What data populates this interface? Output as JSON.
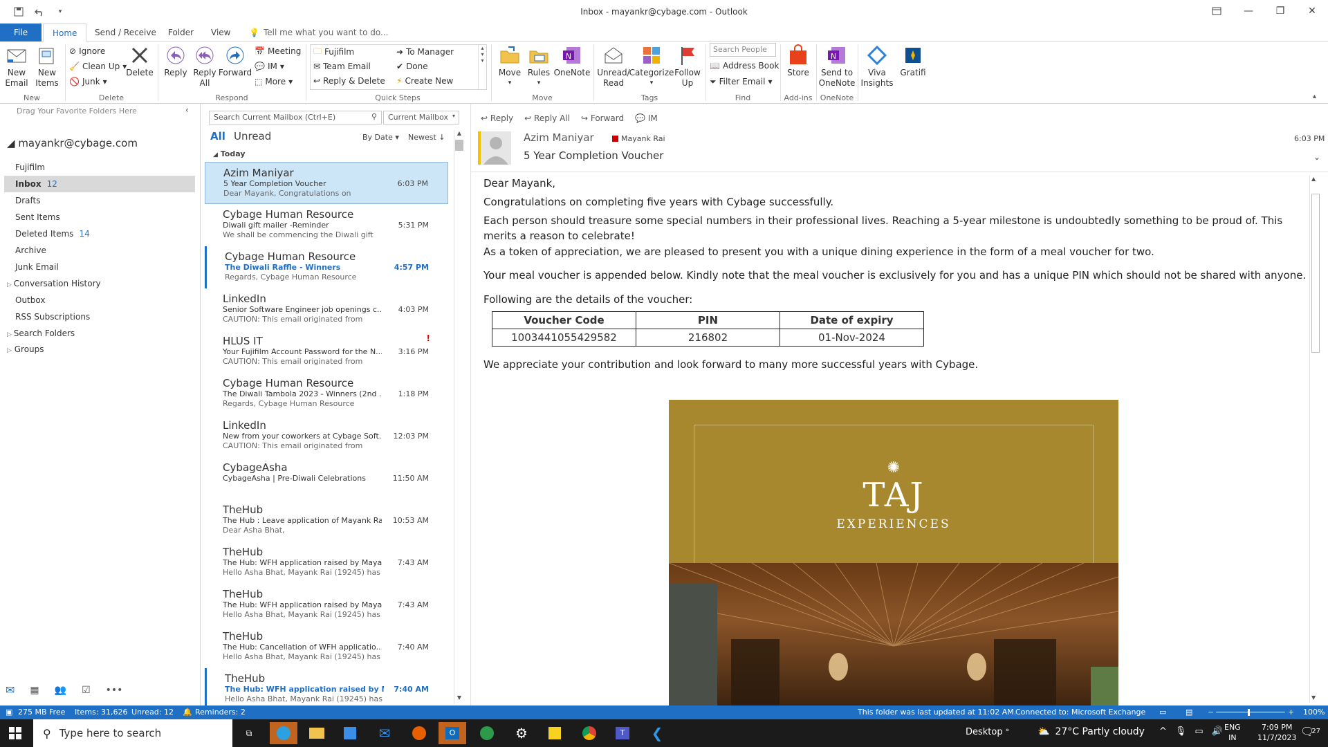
{
  "window": {
    "title": "Inbox - mayankr@cybage.com - Outlook"
  },
  "tabs": [
    "File",
    "Home",
    "Send / Receive",
    "Folder",
    "View"
  ],
  "tell_me": "Tell me what you want to do...",
  "ribbon": {
    "new": {
      "new_email": "New\nEmail",
      "new_items": "New\nItems",
      "label": "New"
    },
    "delete": {
      "ignore": "Ignore",
      "clean_up": "Clean Up",
      "junk": "Junk",
      "delete": "Delete",
      "label": "Delete"
    },
    "respond": {
      "reply": "Reply",
      "reply_all": "Reply\nAll",
      "forward": "Forward",
      "meeting": "Meeting",
      "im": "IM",
      "more": "More",
      "label": "Respond"
    },
    "quick_steps": {
      "items": [
        "Fujifilm",
        "Team Email",
        "Reply & Delete",
        "To Manager",
        "Done",
        "Create New"
      ],
      "label": "Quick Steps"
    },
    "move": {
      "move": "Move",
      "rules": "Rules",
      "onenote": "OneNote",
      "label": "Move"
    },
    "tags": {
      "unread_read": "Unread/\nRead",
      "categorize": "Categorize",
      "follow_up": "Follow\nUp",
      "label": "Tags"
    },
    "find": {
      "search_people": "Search People",
      "address_book": "Address Book",
      "filter_email": "Filter Email",
      "label": "Find"
    },
    "addins": {
      "store": "Store",
      "label": "Add-ins"
    },
    "onenote": {
      "send": "Send to\nOneNote",
      "label": "OneNote"
    },
    "viva": "Viva\nInsights",
    "gratifi": "Gratifi"
  },
  "nav": {
    "drag_hint": "Drag Your Favorite Folders Here",
    "account": "mayankr@cybage.com",
    "folders": [
      {
        "name": "Fujifilm",
        "count": ""
      },
      {
        "name": "Inbox",
        "count": "12"
      },
      {
        "name": "Drafts",
        "count": ""
      },
      {
        "name": "Sent Items",
        "count": ""
      },
      {
        "name": "Deleted Items",
        "count": "14"
      },
      {
        "name": "Archive",
        "count": ""
      },
      {
        "name": "Junk Email",
        "count": ""
      },
      {
        "name": "Conversation History",
        "count": ""
      },
      {
        "name": "Outbox",
        "count": ""
      },
      {
        "name": "RSS Subscriptions",
        "count": ""
      },
      {
        "name": "Search Folders",
        "count": ""
      }
    ],
    "groups": "Groups"
  },
  "list": {
    "search_placeholder": "Search Current Mailbox (Ctrl+E)",
    "scope": "Current Mailbox",
    "filter_all": "All",
    "filter_unread": "Unread",
    "sort": "By Date",
    "order": "Newest",
    "group": "Today",
    "items": [
      {
        "from": "Azim Maniyar",
        "subject": "5 Year Completion Voucher",
        "preview": "Dear Mayank,  Congratulations on",
        "time": "6:03 PM"
      },
      {
        "from": "Cybage Human Resource",
        "subject": "Diwali gift mailer -Reminder",
        "preview": "We shall be commencing the Diwali gift",
        "time": "5:31 PM"
      },
      {
        "from": "Cybage Human Resource",
        "subject": "The Diwali Raffle - Winners",
        "preview": "Regards,  Cybage Human Resource",
        "time": "4:57 PM"
      },
      {
        "from": "LinkedIn",
        "subject": "Senior Software Engineer job openings c...",
        "preview": "CAUTION: This email originated from",
        "time": "4:03 PM"
      },
      {
        "from": "HLUS IT",
        "subject": "Your Fujifilm Account Password for the N...",
        "preview": "CAUTION: This email originated from",
        "time": "3:16 PM"
      },
      {
        "from": "Cybage Human Resource",
        "subject": "The Diwali Tambola 2023 - Winners (2nd ...",
        "preview": "Regards,  Cybage Human Resource",
        "time": "1:18 PM"
      },
      {
        "from": "LinkedIn",
        "subject": "New from your coworkers at Cybage Soft...",
        "preview": "CAUTION: This email originated from",
        "time": "12:03 PM"
      },
      {
        "from": "CybageAsha",
        "subject": "CybageAsha | Pre-Diwali Celebrations",
        "preview": "",
        "time": "11:50 AM"
      },
      {
        "from": "TheHub",
        "subject": "The Hub : Leave application of Mayank Ra...",
        "preview": "Dear Asha Bhat,",
        "time": "10:53 AM"
      },
      {
        "from": "TheHub",
        "subject": "The Hub: WFH application raised by Maya...",
        "preview": "Hello Asha Bhat,  Mayank Rai (19245) has",
        "time": "7:43 AM"
      },
      {
        "from": "TheHub",
        "subject": "The Hub: WFH application raised by Maya...",
        "preview": "Hello Asha Bhat,  Mayank Rai (19245) has",
        "time": "7:43 AM"
      },
      {
        "from": "TheHub",
        "subject": "The Hub: Cancellation of WFH applicatio...",
        "preview": "Hello Asha Bhat,  Mayank Rai (19245) has",
        "time": "7:40 AM"
      },
      {
        "from": "TheHub",
        "subject": "The Hub: WFH application raised by May...",
        "preview": "Hello Asha Bhat,  Mayank Rai (19245) has",
        "time": "7:40 AM"
      }
    ]
  },
  "reading": {
    "actions": [
      "Reply",
      "Reply All",
      "Forward",
      "IM"
    ],
    "sender": "Azim Maniyar",
    "to": "Mayank Rai",
    "subject": "5 Year Completion Voucher",
    "time": "6:03 PM",
    "body": {
      "greeting": "Dear Mayank,",
      "p1": "Congratulations on completing five years with Cybage successfully.",
      "p2": "Each person should treasure some special numbers in their professional lives. Reaching a 5-year milestone is undoubtedly something to be proud of. This merits a reason to celebrate!",
      "p3": "As a token of appreciation, we are pleased to present you with a unique dining experience in the form of a meal voucher for two.",
      "p4": "Your meal voucher is appended below. Kindly note that the meal voucher is exclusively for you and has a unique PIN which should not be shared with anyone.",
      "p5": "Following are the details of the voucher:",
      "table_headers": [
        "Voucher Code",
        "PIN",
        "Date of expiry"
      ],
      "table_row": [
        "1003441055429582",
        "216802",
        "01-Nov-2024"
      ],
      "p6": "We appreciate your contribution and look forward to many more successful years with Cybage.",
      "banner_title": "TAJ",
      "banner_sub": "EXPERIENCES"
    }
  },
  "status": {
    "free": "275 MB Free",
    "items": "Items: 31,626",
    "unread": "Unread: 12",
    "reminders": "Reminders: 2",
    "updated": "This folder was last updated at 11:02 AM.",
    "connected": "Connected to: Microsoft Exchange",
    "zoom": "100%"
  },
  "taskbar": {
    "search": "Type here to search",
    "desktop": "Desktop",
    "weather": "27°C  Partly cloudy",
    "lang1": "ENG",
    "lang2": "IN",
    "time": "7:09 PM",
    "date": "11/7/2023",
    "notif": "27"
  }
}
